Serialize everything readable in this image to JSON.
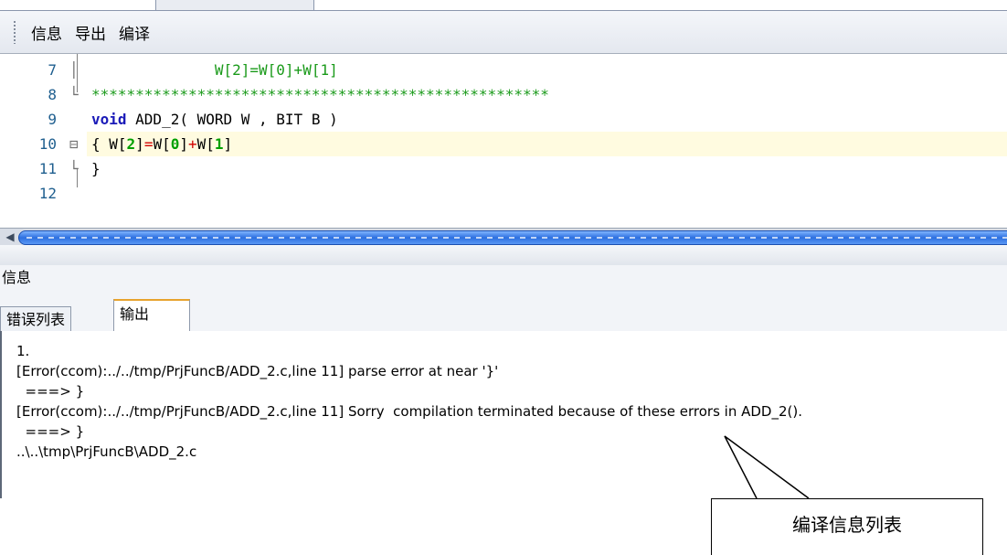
{
  "menubar": {
    "items": [
      "信息",
      "导出",
      "编译"
    ]
  },
  "editor": {
    "lines": [
      {
        "num": "7",
        "fold": "│",
        "segments": [
          {
            "t": "              W[2]=W[0]+W[1]",
            "c": "green"
          }
        ]
      },
      {
        "num": "8",
        "fold": "└",
        "segments": [
          {
            "t": "****************************************************",
            "c": "green"
          }
        ]
      },
      {
        "num": "9",
        "fold": "",
        "segments": [
          {
            "t": "void",
            "c": "kw"
          },
          {
            "t": " ADD_2( WORD W , BIT B )",
            "c": ""
          }
        ]
      },
      {
        "num": "10",
        "fold": "⊟",
        "current": true,
        "segments": [
          {
            "t": "{ W[",
            "c": ""
          },
          {
            "t": "2",
            "c": "num"
          },
          {
            "t": "]",
            "c": ""
          },
          {
            "t": "=",
            "c": "red"
          },
          {
            "t": "W[",
            "c": ""
          },
          {
            "t": "0",
            "c": "num"
          },
          {
            "t": "]",
            "c": ""
          },
          {
            "t": "+",
            "c": "red"
          },
          {
            "t": "W[",
            "c": ""
          },
          {
            "t": "1",
            "c": "num"
          },
          {
            "t": "]",
            "c": ""
          }
        ]
      },
      {
        "num": "11",
        "fold": "└",
        "segments": [
          {
            "t": "}",
            "c": ""
          }
        ]
      },
      {
        "num": "12",
        "fold": "",
        "segments": []
      }
    ]
  },
  "info_panel": {
    "title": "信息",
    "tabs": [
      {
        "label": "错误列表",
        "active": false
      },
      {
        "label": "输出",
        "active": true
      }
    ],
    "output_lines": [
      "1.",
      "[Error(ccom):../../tmp/PrjFuncB/ADD_2.c,line 11] parse error at near '}'",
      "  ===> }",
      "[Error(ccom):../../tmp/PrjFuncB/ADD_2.c,line 11] Sorry  compilation terminated because of these errors in ADD_2().",
      "  ===> }",
      "..\\..\\tmp\\PrjFuncB\\ADD_2.c"
    ]
  },
  "callout": {
    "text": "编译信息列表"
  },
  "colors": {
    "accent_tab": "#e7a32e",
    "scroll_thumb": "#2d6fe0",
    "keyword": "#1a1ab8",
    "comment": "#1a9a1a"
  }
}
